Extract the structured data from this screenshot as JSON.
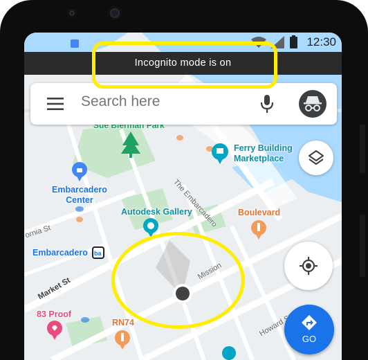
{
  "status_bar": {
    "time": "12:30"
  },
  "incognito_banner": {
    "text": "Incognito mode is on"
  },
  "search": {
    "placeholder": "Search here",
    "menu_icon": "hamburger-icon",
    "mic_icon": "microphone-icon",
    "account_icon": "incognito-icon"
  },
  "controls": {
    "layers_icon": "layers-icon",
    "location_icon": "my-location-icon",
    "go_label": "GO",
    "go_icon": "directions-icon"
  },
  "map": {
    "places": {
      "ferry_building": "Ferry Building\nMarketplace",
      "embarcadero_center": "Embarcadero\nCenter",
      "autodesk_gallery": "Autodesk Gallery",
      "boulevard": "Boulevard",
      "embarcadero_station": "Embarcadero",
      "proof_83": "83 Proof",
      "rn74": "RN74",
      "top_partial": "Sue Bierman Park"
    },
    "streets": {
      "the_embarcadero": "The Embarcadero",
      "california_st": "ornia St",
      "market_st": "Market St",
      "mission": "Mission",
      "howard_st": "Howard St"
    }
  },
  "colors": {
    "blue_accent": "#1a73e8",
    "highlight": "#ffee00",
    "banner_bg": "#2b2b2b",
    "park": "#c8e6c9",
    "water": "#aadaff"
  }
}
